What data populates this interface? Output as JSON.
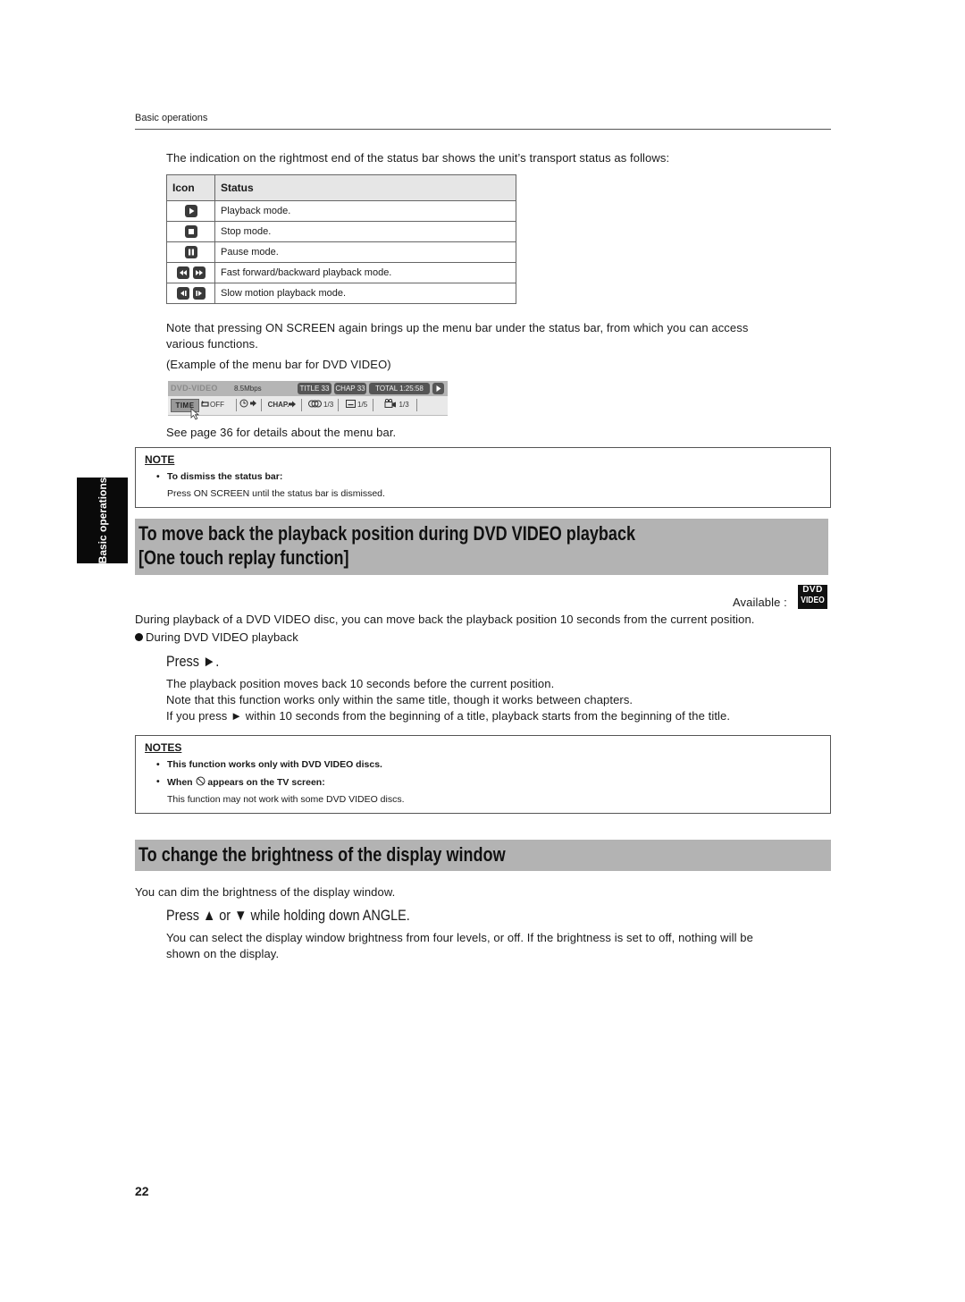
{
  "header": {
    "breadcrumb": "Basic operations"
  },
  "side_tab": {
    "label": "Basic operations"
  },
  "intro": {
    "text": "The indication on the rightmost end of the status bar shows the unit’s transport status as follows:"
  },
  "status_table": {
    "columns": [
      "Icon",
      "Status"
    ],
    "rows": [
      {
        "icons": [
          "play-icon"
        ],
        "status": "Playback mode."
      },
      {
        "icons": [
          "stop-icon"
        ],
        "status": "Stop mode."
      },
      {
        "icons": [
          "pause-icon"
        ],
        "status": "Pause mode."
      },
      {
        "icons": [
          "fast-backward-icon",
          "fast-forward-icon"
        ],
        "status": "Fast forward/backward playback mode."
      },
      {
        "icons": [
          "slow-backward-icon",
          "slow-forward-icon"
        ],
        "status": "Slow motion playback mode."
      }
    ]
  },
  "menu_note": {
    "line1": "Note that pressing ON SCREEN again brings up the menu bar under the status bar, from which you can access",
    "line2": "various functions.",
    "example_caption": "(Example of the menu bar for DVD VIDEO)",
    "see_page": "See page 36 for details about the menu bar."
  },
  "menu_bar": {
    "disc_type": "DVD-VIDEO",
    "bitrate": "8.5Mbps",
    "title": "TITLE 33",
    "chapter": "CHAP 33",
    "total": "TOTAL 1:25:58",
    "status_icon": "play-icon",
    "items": {
      "time": "TIME",
      "repeat": "OFF",
      "chap": "CHAP.",
      "audio": "1/3",
      "subtitle": "1/5",
      "angle": "1/3"
    }
  },
  "note1": {
    "title": "NOTE",
    "bullet": "To dismiss the status bar:",
    "text": "Press ON SCREEN until the status bar is dismissed."
  },
  "section1": {
    "heading_line1": "To move back the playback position during DVD VIDEO playback",
    "heading_line2": "[One touch replay function]",
    "available_label": "Available :",
    "badge_top": "DVD",
    "badge_bottom": "VIDEO",
    "description": "During playback of a DVD VIDEO disc, you can move back the playback position 10 seconds from the current position.",
    "condition": "During DVD VIDEO playback",
    "step": "Press ►.",
    "details": [
      "The playback position moves back 10 seconds before the current position.",
      "Note that this function works only within the same title, though it works between chapters.",
      "If you press ► within 10 seconds from the beginning of a title, playback starts from the beginning of the title."
    ]
  },
  "note2": {
    "title": "NOTES",
    "bullet1": "This function works only with DVD VIDEO discs.",
    "bullet2_pre": "When",
    "bullet2_post": "appears on the TV screen:",
    "text": "This function may not work with some DVD VIDEO discs."
  },
  "section2": {
    "heading": "To change the brightness of the display window",
    "description": "You can dim the brightness of the display window.",
    "step": "Press ▲ or ▼ while holding down ANGLE.",
    "detail_line1": "You can select the display window brightness from four levels, or off. If the brightness is set to off, nothing will be",
    "detail_line2": "shown on the display."
  },
  "footer": {
    "page_number": "22"
  }
}
